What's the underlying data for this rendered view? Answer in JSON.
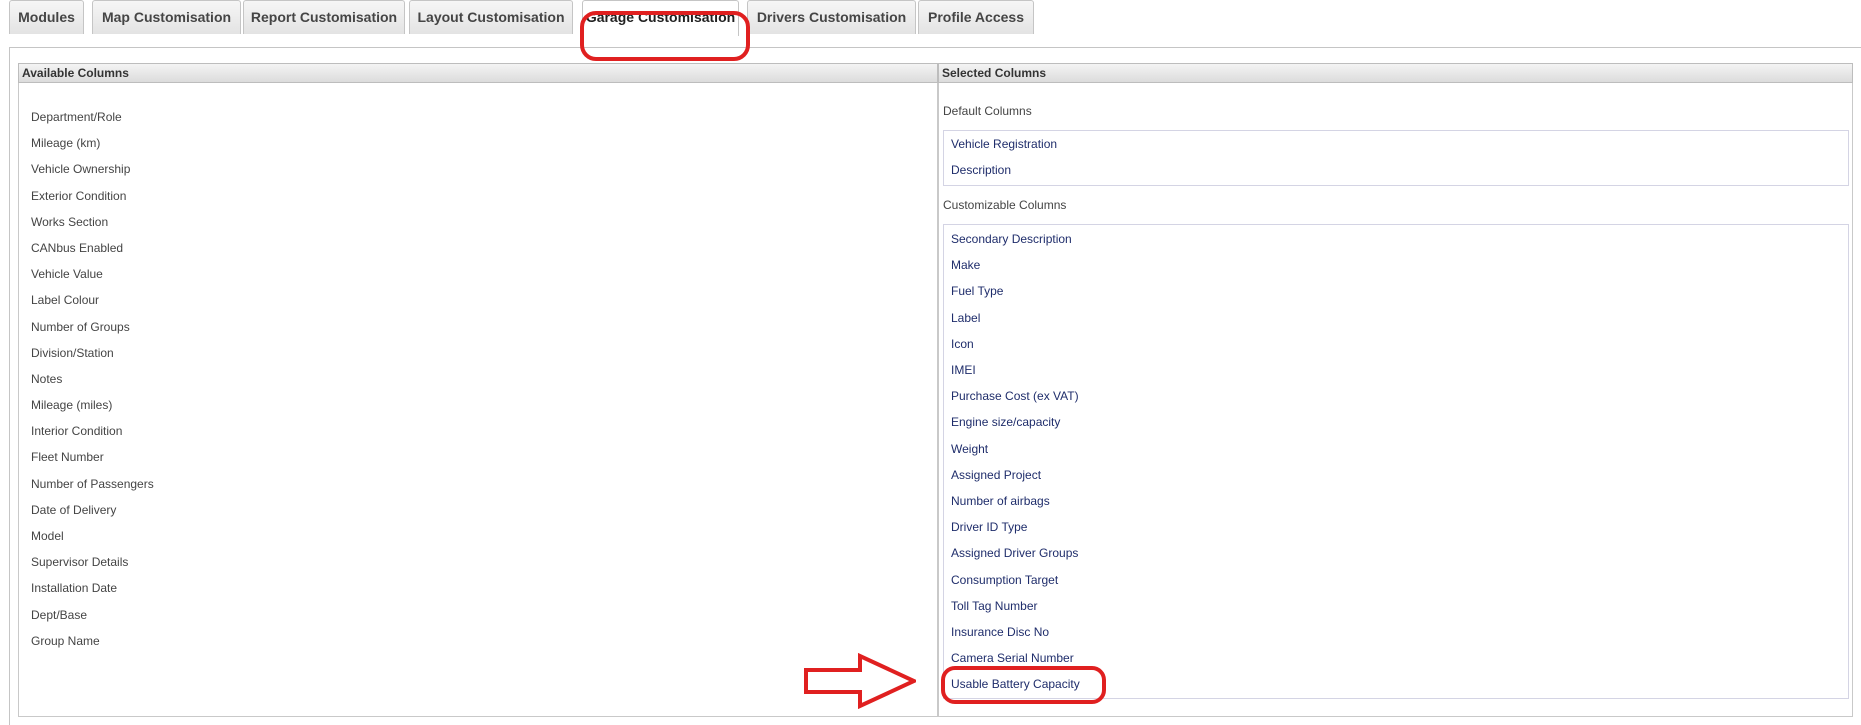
{
  "tabs": [
    {
      "label": "Modules"
    },
    {
      "label": "Map Customisation"
    },
    {
      "label": "Report Customisation"
    },
    {
      "label": "Layout Customisation"
    },
    {
      "label": "Garage Customisation"
    },
    {
      "label": "Drivers Customisation"
    },
    {
      "label": "Profile Access"
    }
  ],
  "available": {
    "header": "Available Columns",
    "items": [
      "Department/Role",
      "Mileage (km)",
      "Vehicle Ownership",
      "Exterior Condition",
      "Works Section",
      "CANbus Enabled",
      "Vehicle Value",
      "Label Colour",
      "Number of Groups",
      "Division/Station",
      "Notes",
      "Mileage (miles)",
      "Interior Condition",
      "Fleet Number",
      "Number of Passengers",
      "Date of Delivery",
      "Model",
      "Supervisor Details",
      "Installation Date",
      "Dept/Base",
      "Group Name"
    ]
  },
  "selected": {
    "header": "Selected Columns",
    "default_label": "Default Columns",
    "default_items": [
      "Vehicle Registration",
      "Description"
    ],
    "custom_label": "Customizable Columns",
    "custom_items": [
      "Secondary Description",
      "Make",
      "Fuel Type",
      "Label",
      "Icon",
      "IMEI",
      "Purchase Cost (ex VAT)",
      "Engine size/capacity",
      "Weight",
      "Assigned Project",
      "Number of airbags",
      "Driver ID Type",
      "Assigned Driver Groups",
      "Consumption Target",
      "Toll Tag Number",
      "Insurance Disc No",
      "Camera Serial Number",
      "Usable Battery Capacity"
    ]
  },
  "colors": {
    "highlight": "#e02020",
    "selected_text": "#1f2d6b"
  },
  "annotation_icon": "right-arrow-icon"
}
